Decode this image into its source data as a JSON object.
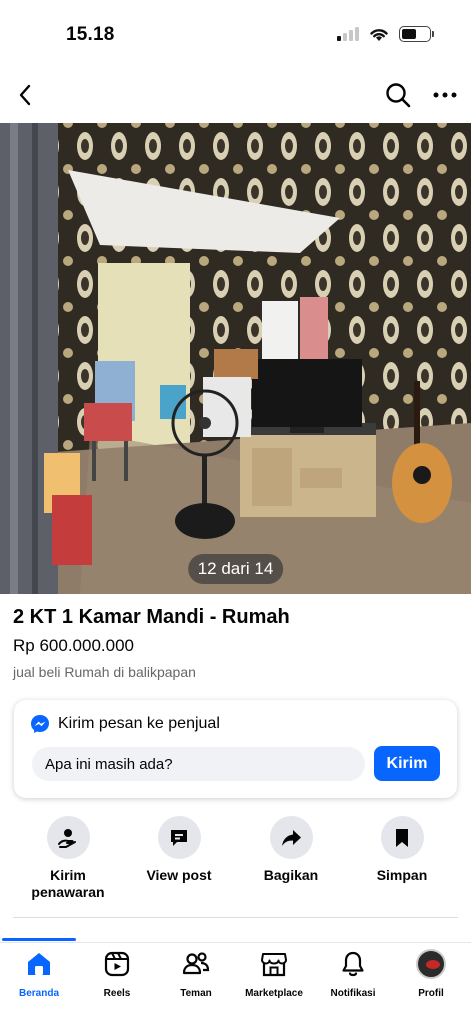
{
  "status_bar": {
    "time": "15.18",
    "signal_bars_on": 1,
    "battery_level": 0.55
  },
  "top_nav": {
    "back_icon": "chevron-left-icon",
    "search_icon": "search-icon",
    "more_icon": "more-horizontal-icon"
  },
  "listing": {
    "photo_counter": "12 dari 14",
    "title": "2 KT 1 Kamar Mandi - Rumah",
    "price": "Rp 600.000.000",
    "location": "jual beli Rumah di balikpapan"
  },
  "message_card": {
    "heading": "Kirim pesan ke penjual",
    "input_value": "Apa ini masih ada?",
    "send_label": "Kirim",
    "icon": "messenger-icon"
  },
  "actions": [
    {
      "label": "Kirim penawaran",
      "icon": "offer-icon"
    },
    {
      "label": "View post",
      "icon": "post-icon"
    },
    {
      "label": "Bagikan",
      "icon": "share-icon"
    },
    {
      "label": "Simpan",
      "icon": "bookmark-icon"
    }
  ],
  "tabs": [
    {
      "label": "Beranda",
      "icon": "home-icon",
      "active": true
    },
    {
      "label": "Reels",
      "icon": "reels-icon",
      "active": false
    },
    {
      "label": "Teman",
      "icon": "friends-icon",
      "active": false
    },
    {
      "label": "Marketplace",
      "icon": "marketplace-icon",
      "active": false
    },
    {
      "label": "Notifikasi",
      "icon": "bell-icon",
      "active": false
    },
    {
      "label": "Profil",
      "icon": "avatar",
      "active": false
    }
  ],
  "colors": {
    "accent": "#0866ff",
    "muted_text": "#65676b",
    "card_bg": "#f0f2f5"
  }
}
